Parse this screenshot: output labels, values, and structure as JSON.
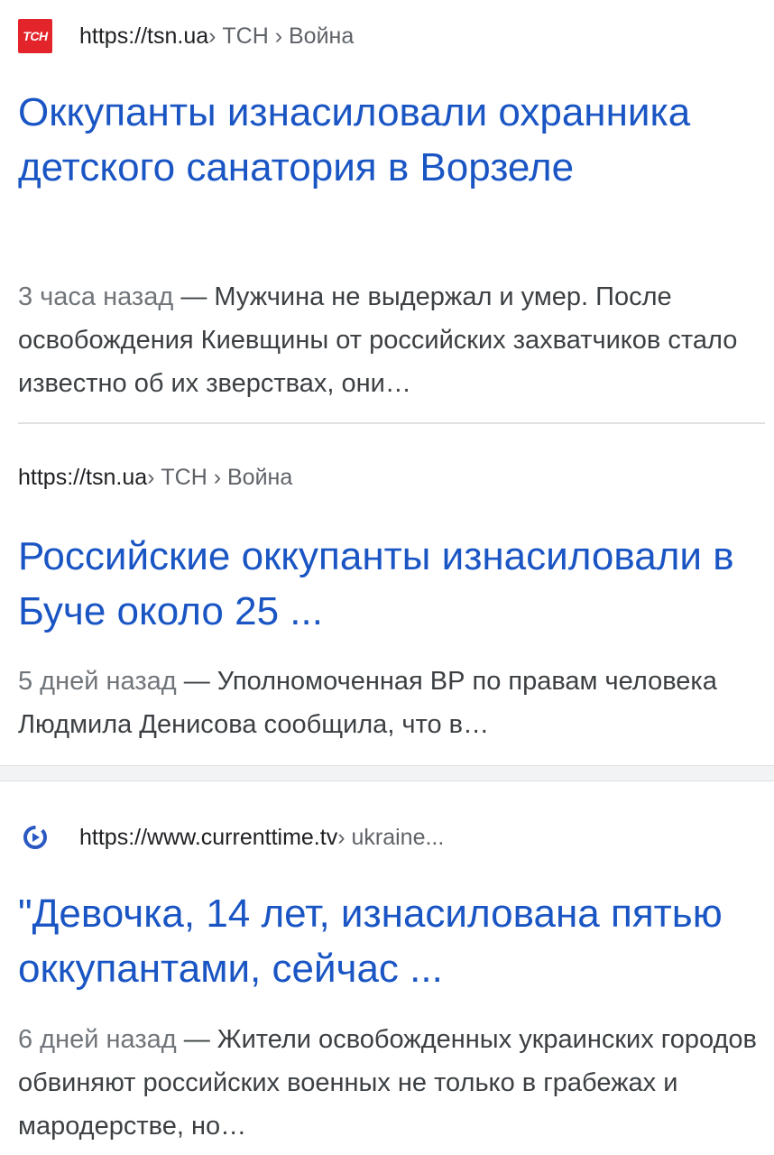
{
  "results": [
    {
      "host": "https://tsn.ua",
      "crumbs": " › ТСН › Война",
      "favicon": "tsn-logo-icon",
      "favicon_text": "ТСН",
      "title": "Оккупанты изнасиловали охранника детского санатория в Ворзеле",
      "date": "3 часа назад",
      "snippet": " — Мужчина не выдержал и умер. После освобождения Киевщины от российских захватчиков стало известно об их зверствах, они…"
    },
    {
      "host": "https://tsn.ua",
      "crumbs": " › ТСН › Война",
      "title": "Российские оккупанты изнасиловали в Буче около 25 ...",
      "date": "5 дней назад",
      "snippet": " — Уполномоченная ВР по правам человека Людмила Денисова сообщила, что в…"
    },
    {
      "host": "https://www.currenttime.tv",
      "crumbs": " › ukraine...",
      "favicon": "currenttime-logo-icon",
      "title": "\"Девочка, 14 лет, изнасилована пятью оккупантами, сейчас ...",
      "date": "6 дней назад",
      "snippet": " — Жители освобожденных украинских городов обвиняют российских военных не только в грабежах и мародерстве, но…"
    }
  ],
  "colors": {
    "link": "#1a55c4",
    "tsn_red": "#e3242b",
    "ct_blue": "#2b59c3"
  }
}
